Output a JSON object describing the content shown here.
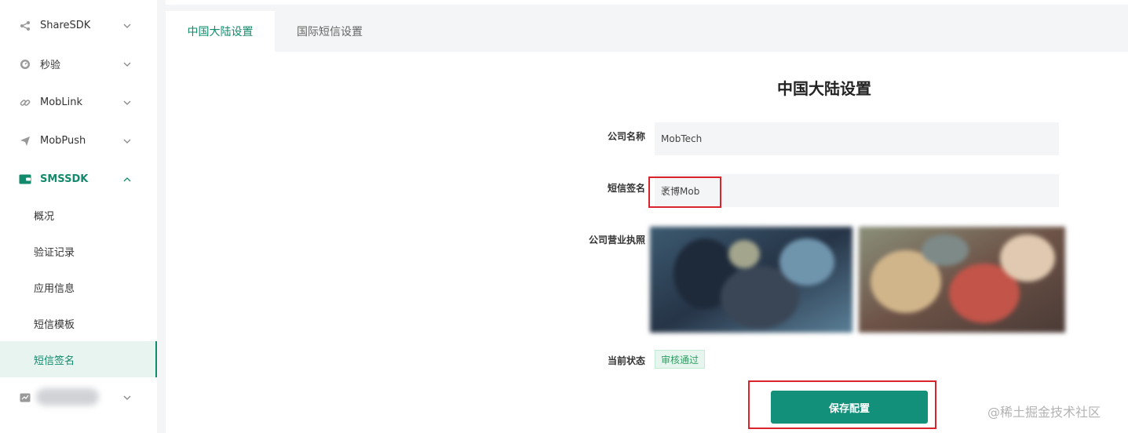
{
  "sidebar": {
    "items": [
      {
        "label": "ShareSDK",
        "icon": "share-icon"
      },
      {
        "label": "秒验",
        "icon": "clock-icon"
      },
      {
        "label": "MobLink",
        "icon": "link-icon"
      },
      {
        "label": "MobPush",
        "icon": "paper-plane-icon"
      },
      {
        "label": "SMSSDK",
        "icon": "wallet-icon"
      }
    ],
    "sms_sub": [
      {
        "label": "概况"
      },
      {
        "label": "验证记录"
      },
      {
        "label": "应用信息"
      },
      {
        "label": "短信模板"
      },
      {
        "label": "短信签名"
      }
    ],
    "selected": "短信签名"
  },
  "tabs": [
    {
      "label": "中国大陆设置"
    },
    {
      "label": "国际短信设置"
    }
  ],
  "form": {
    "title": "中国大陆设置",
    "company_name_label": "公司名称",
    "company_name_value": "MobTech",
    "sms_sign_label": "短信签名",
    "sms_sign_value": "袤博Mob",
    "license_label": "公司营业执照",
    "status_label": "当前状态",
    "status_value": "审核通过",
    "save_label": "保存配置"
  },
  "watermark": "@稀土掘金技术社区",
  "colors": {
    "accent": "#13907a",
    "highlight": "#d9232d",
    "status_green": "#2e9d63"
  }
}
